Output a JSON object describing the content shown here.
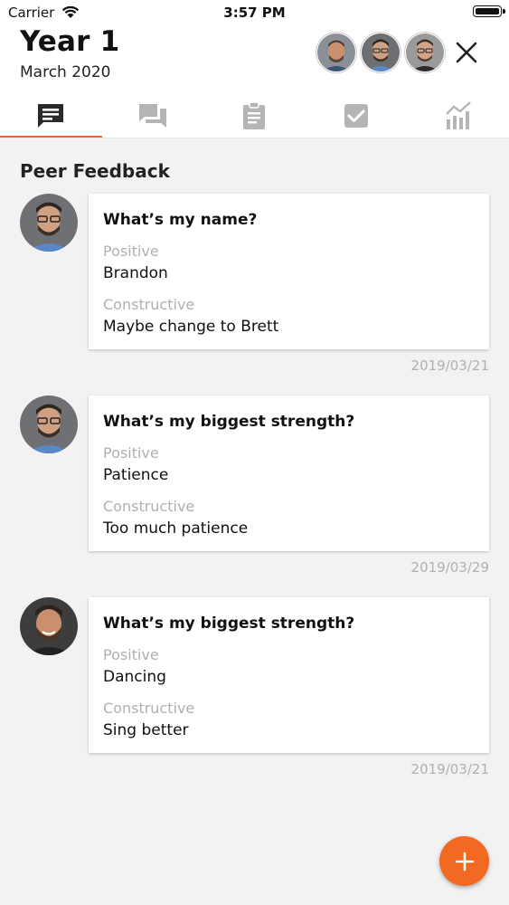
{
  "status_bar": {
    "carrier": "Carrier",
    "time": "3:57 PM"
  },
  "header": {
    "title": "Year 1",
    "subtitle": "March 2020",
    "participants": [
      {
        "icon": "avatar-face-1"
      },
      {
        "icon": "avatar-face-2"
      },
      {
        "icon": "avatar-face-3"
      }
    ]
  },
  "tabs": [
    {
      "icon": "feedback-icon",
      "active": true
    },
    {
      "icon": "chat-icon",
      "active": false
    },
    {
      "icon": "clipboard-icon",
      "active": false
    },
    {
      "icon": "checkbox-icon",
      "active": false
    },
    {
      "icon": "analytics-icon",
      "active": false
    }
  ],
  "section": {
    "title": "Peer Feedback"
  },
  "labels": {
    "positive": "Positive",
    "constructive": "Constructive"
  },
  "feedback": [
    {
      "question": "What’s my name?",
      "positive": "Brandon",
      "constructive": "Maybe change to Brett",
      "date": "2019/03/21"
    },
    {
      "question": "What’s my biggest strength?",
      "positive": "Patience",
      "constructive": "Too much patience",
      "date": "2019/03/29"
    },
    {
      "question": "What’s my biggest strength?",
      "positive": "Dancing",
      "constructive": "Sing better",
      "date": "2019/03/21"
    }
  ],
  "colors": {
    "accent": "#e8692a",
    "fab": "#f26a21",
    "muted_text": "#b0b0b0",
    "background": "#f2f2f2"
  }
}
